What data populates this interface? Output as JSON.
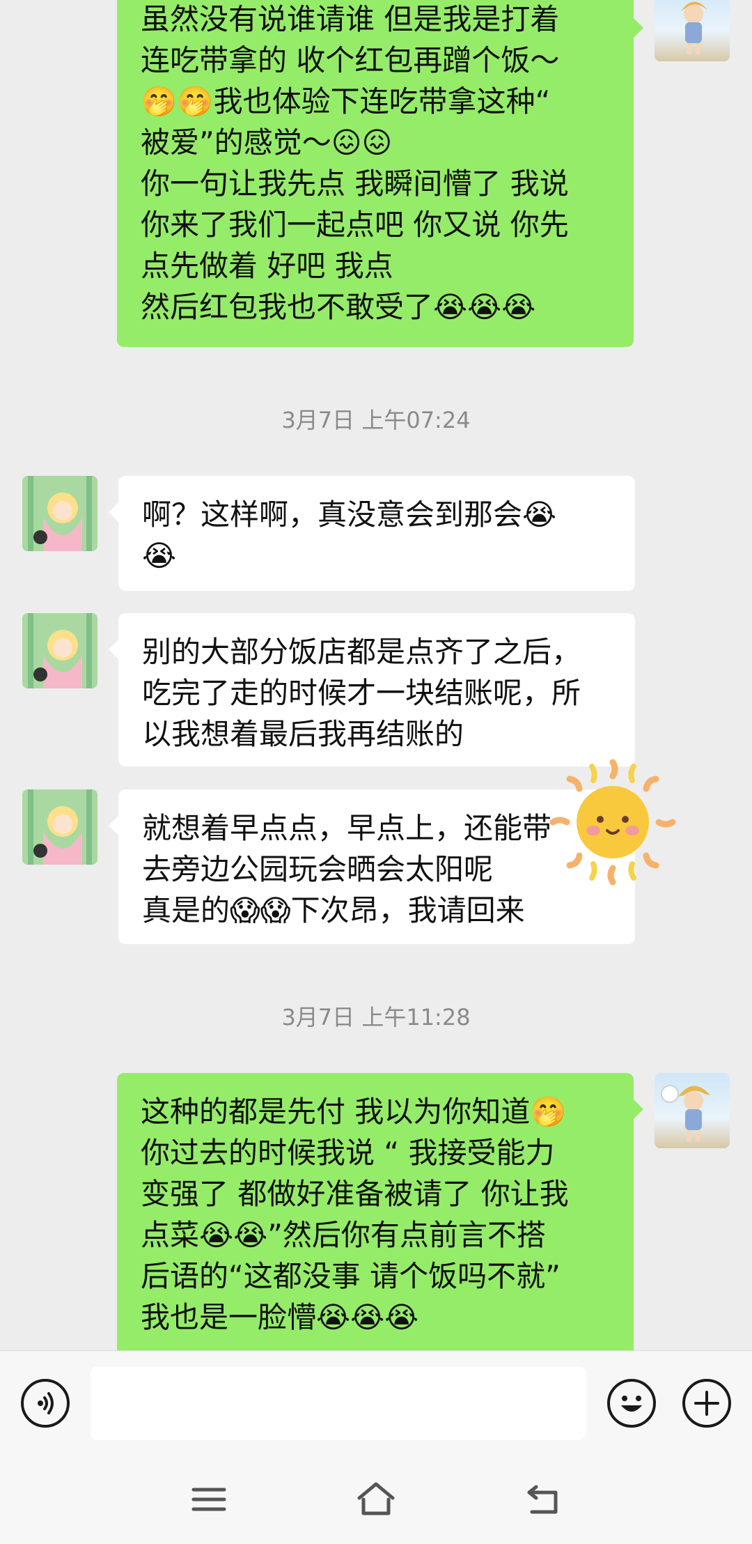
{
  "chat": {
    "messages": [
      {
        "side": "out",
        "text": "虽然没有说谁请谁 但是我是打着\n连吃带拿的 收个红包再蹭个饭～\n🤭🤭我也体验下连吃带拿这种“\n被爱”的感觉～😖😖\n你一句让我先点 我瞬间懵了 我说\n你来了我们一起点吧 你又说 你先\n点先做着 好吧 我点\n然后红包我也不敢受了😭😭😭"
      },
      {
        "type": "time",
        "text": "3月7日 上午07:24"
      },
      {
        "side": "in",
        "text": "啊？这样啊，真没意会到那会😭\n😭"
      },
      {
        "side": "in",
        "text": "别的大部分饭店都是点齐了之后，\n吃完了走的时候才一块结账呢，所\n以我想着最后我再结账的"
      },
      {
        "side": "in",
        "text": "就想着早点点，早点上，还能带\n去旁边公园玩会晒会太阳呢\n真是的😱😱下次昂，我请回来"
      },
      {
        "type": "time",
        "text": "3月7日 上午11:28"
      },
      {
        "side": "out",
        "text": "这种的都是先付 我以为你知道🤭\n你过去的时候我说 “ 我接受能力\n变强了 都做好准备被请了 你让我\n点菜😭😭”然后你有点前言不搭\n后语的“这都没事 请个饭吗不就”\n我也是一脸懵😭😭😭"
      }
    ]
  },
  "sticker": {
    "icon": "sun-sticker-icon"
  },
  "input_bar": {
    "voice_icon": "voice-icon",
    "input_value": "",
    "emoji_icon": "emoji-icon",
    "plus_icon": "plus-icon"
  },
  "nav_bar": {
    "menu_icon": "menu-icon",
    "home_icon": "home-icon",
    "back_icon": "back-icon"
  },
  "colors": {
    "background": "#EDEDED",
    "outgoing_bubble": "#95EC69",
    "incoming_bubble": "#FFFFFF",
    "timestamp": "#8A8A8A"
  }
}
